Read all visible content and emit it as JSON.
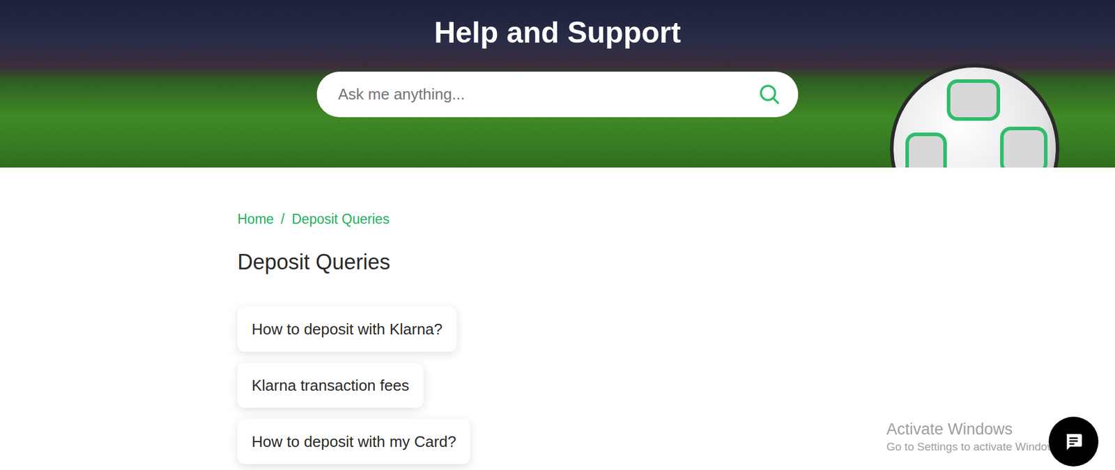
{
  "page": {
    "title": "Help and Support"
  },
  "search": {
    "placeholder": "Ask me anything..."
  },
  "breadcrumb": [
    {
      "label": "Home"
    },
    {
      "label": "Deposit Queries"
    }
  ],
  "section": {
    "heading": "Deposit Queries"
  },
  "articles": [
    {
      "label": "How to deposit with Klarna?"
    },
    {
      "label": "Klarna transaction fees"
    },
    {
      "label": "How to deposit with my Card?"
    }
  ],
  "watermark": {
    "title": "Activate Windows",
    "subtitle": "Go to Settings to activate Windows."
  }
}
